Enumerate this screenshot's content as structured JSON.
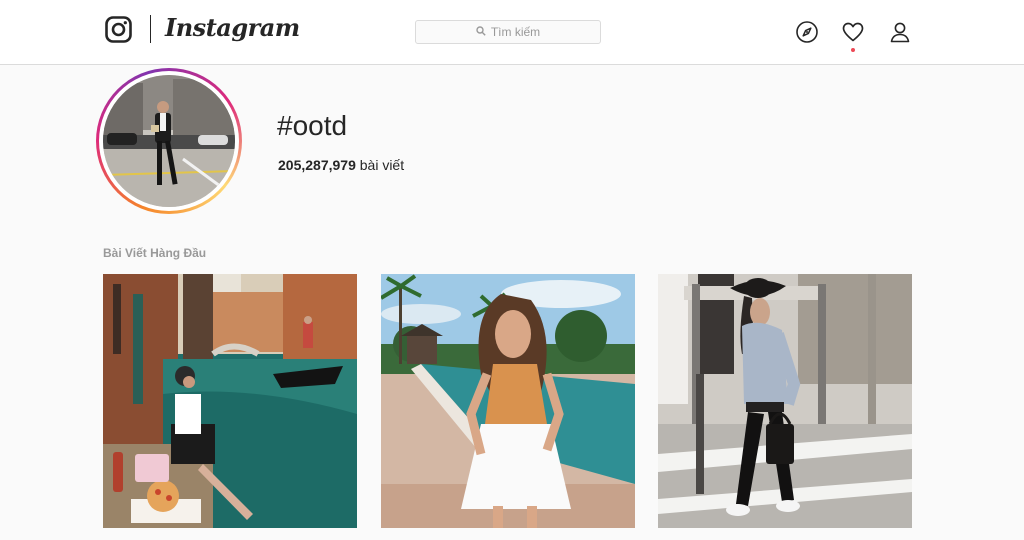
{
  "app": {
    "name": "Instagram"
  },
  "header": {
    "search_placeholder": "Tìm kiếm",
    "icons": [
      "instagram-glyph-icon",
      "search-icon",
      "compass-icon",
      "heart-icon",
      "user-icon"
    ],
    "notification_dot_color": "#ed4956"
  },
  "tag": {
    "name": "#ootd",
    "post_count": "205,287,979",
    "post_suffix": "bài viết"
  },
  "top_posts": {
    "label": "Bài Viết Hàng Đầu"
  },
  "colors": {
    "text": "#262626",
    "muted": "#999999",
    "border": "#dbdbdb",
    "background": "#fafafa"
  }
}
